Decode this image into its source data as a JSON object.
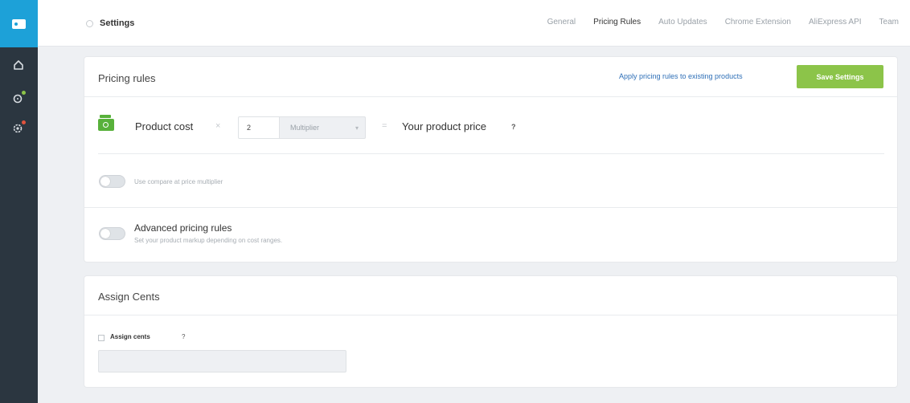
{
  "sidebar": {
    "items": [
      {
        "icon": "home-icon"
      },
      {
        "icon": "tag-icon",
        "badge_color": "#8cc449"
      },
      {
        "icon": "gear-icon",
        "badge_color": "#e0533d"
      }
    ],
    "logo_color": "#1da1d8"
  },
  "header": {
    "title": "Settings",
    "tabs": [
      {
        "label": "General"
      },
      {
        "label": "Pricing Rules",
        "active": true
      },
      {
        "label": "Auto Updates"
      },
      {
        "label": "Chrome Extension"
      },
      {
        "label": "AliExpress API"
      },
      {
        "label": "Team"
      }
    ]
  },
  "pricing": {
    "title": "Pricing rules",
    "apply_link": "Apply pricing rules to existing products",
    "save_label": "Save Settings",
    "product_cost_label": "Product cost",
    "multiply_symbol": "×",
    "multiplier_value": "2",
    "multiplier_type": "Multiplier",
    "equals_symbol": "=",
    "product_price_label": "Your product price",
    "help_mark": "?",
    "compare_label": "Use compare at price multiplier",
    "advanced_title": "Advanced pricing rules",
    "advanced_subtitle": "Set your product markup depending on cost ranges."
  },
  "cents": {
    "title": "Assign Cents",
    "checkbox_label": "Assign cents",
    "help_mark": "?"
  },
  "colors": {
    "accent_green": "#8cc449",
    "link_blue": "#2e6fb7",
    "sidebar_bg": "#2b3640"
  }
}
